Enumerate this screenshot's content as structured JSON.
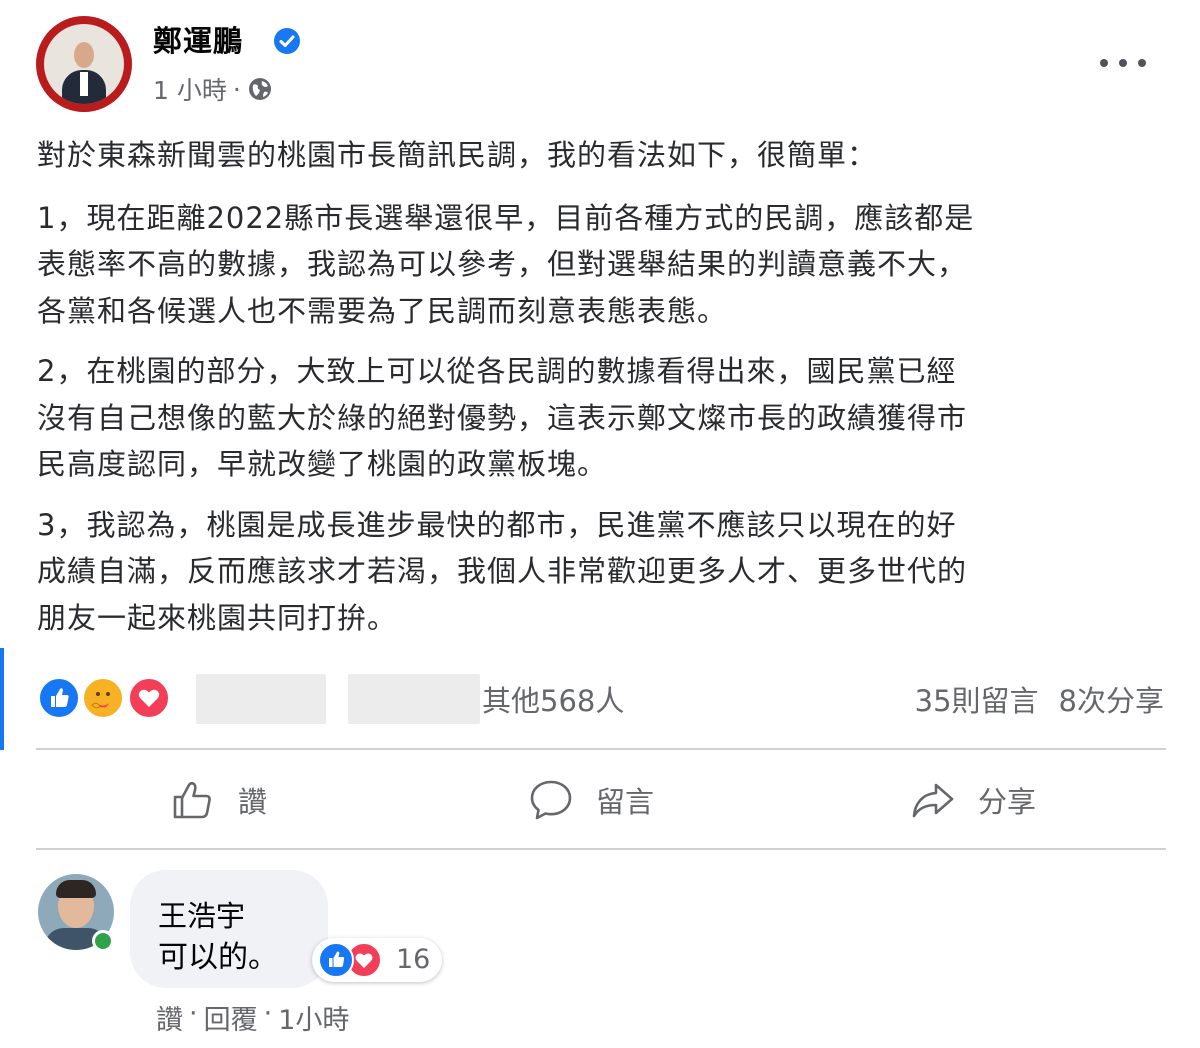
{
  "post": {
    "author": "鄭運鵬",
    "timestamp": "1 小時",
    "separator": "·",
    "verified_icon": "verified-badge-icon",
    "audience_icon": "globe-icon",
    "paragraphs": [
      "對於東森新聞雲的桃園市長簡訊民調，我的看法如下，很簡單：",
      "1，現在距離2022縣市長選舉還很早，目前各種方式的民調，應該都是\n表態率不高的數據，我認為可以參考，但對選舉結果的判讀意義不大，\n各黨和各候選人也不需要為了民調而刻意表態表態。",
      "2，在桃園的部分，大致上可以從各民調的數據看得出來，國民黨已經\n沒有自己想像的藍大於綠的絕對優勢，這表示鄭文燦市長的政績獲得市\n民高度認同，早就改變了桃園的政黨板塊。",
      "3，我認為，桃園是成長進步最快的都市，民進黨不應該只以現在的好\n成績自滿，反而應該求才若渴，我個人非常歡迎更多人才、更多世代的\n朋友一起來桃園共同打拚。"
    ]
  },
  "reactions": {
    "icons": [
      "like-icon",
      "care-icon",
      "love-icon"
    ],
    "others": "其他568人",
    "comments_count": "35則留言",
    "shares_count": "8次分享"
  },
  "actions": {
    "like": "讚",
    "comment": "留言",
    "share": "分享"
  },
  "comment": {
    "author": "王浩宇",
    "text": "可以的。",
    "reaction_count": "16",
    "like_link": "讚",
    "reply_link": "回覆",
    "dot": "·",
    "time": "1小時"
  },
  "colors": {
    "accent": "#1877f2",
    "love": "#f33e58",
    "care": "#f7b125",
    "online": "#31a24c",
    "secondary_text": "#65676b"
  }
}
